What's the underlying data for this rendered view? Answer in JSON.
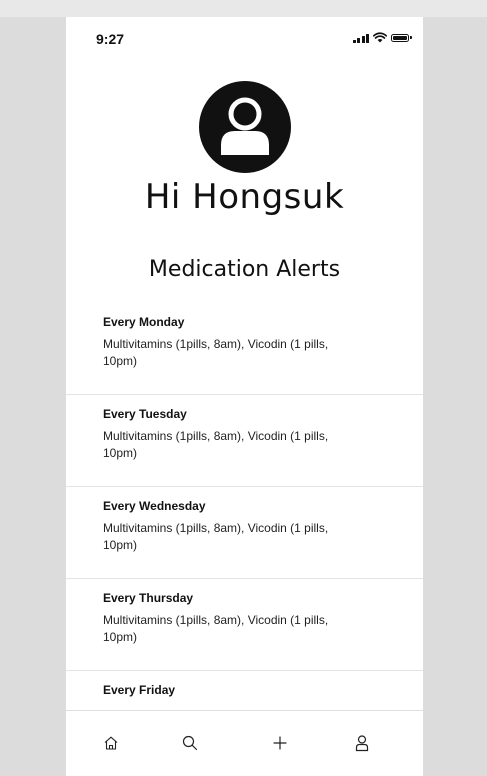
{
  "status_bar": {
    "time": "9:27"
  },
  "profile": {
    "icon": "user-avatar-icon",
    "greeting": "Hi Hongsuk"
  },
  "section_title": "Medication Alerts",
  "alerts": [
    {
      "day": "Every Monday",
      "detail": "Multivitamins (1pills, 8am), Vicodin (1 pills, 10pm)"
    },
    {
      "day": "Every Tuesday",
      "detail": "Multivitamins (1pills, 8am), Vicodin (1 pills, 10pm)"
    },
    {
      "day": "Every Wednesday",
      "detail": "Multivitamins (1pills, 8am), Vicodin (1 pills, 10pm)"
    },
    {
      "day": "Every Thursday",
      "detail": "Multivitamins (1pills, 8am), Vicodin (1 pills, 10pm)"
    },
    {
      "day": "Every Friday",
      "detail": ""
    }
  ],
  "tab_bar": {
    "items": [
      "home-icon",
      "search-icon",
      "plus-icon",
      "profile-icon"
    ]
  },
  "colors": {
    "background": "#dcdcdc",
    "screen": "#ffffff",
    "text": "#111111",
    "divider": "#e4e4e4"
  }
}
